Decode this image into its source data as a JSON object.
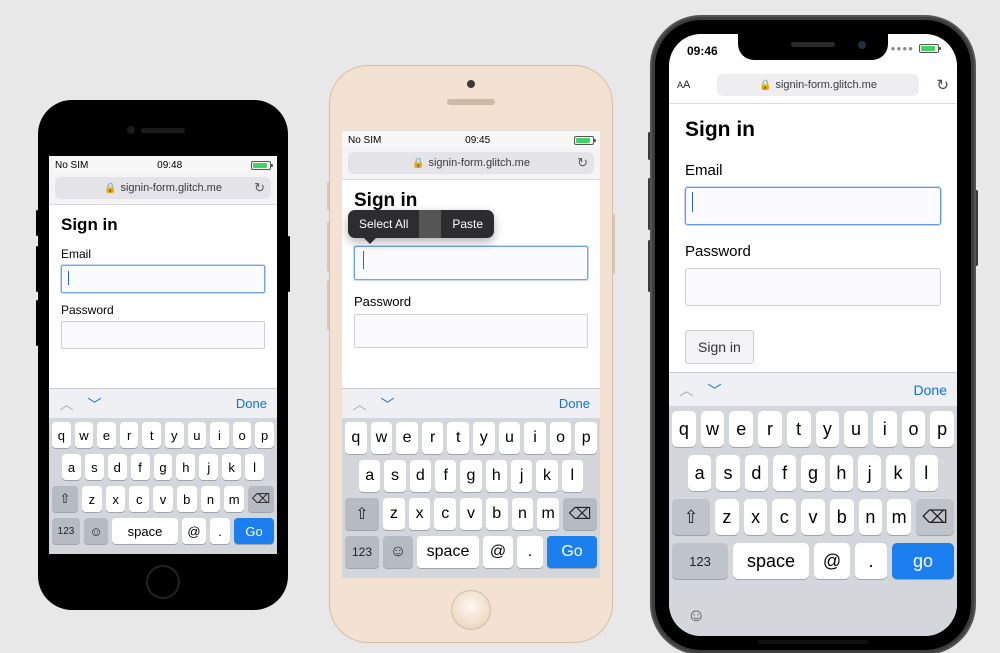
{
  "url_domain": "signin-form.glitch.me",
  "form": {
    "title": "Sign in",
    "email_label": "Email",
    "password_label": "Password",
    "signin_button": "Sign in"
  },
  "context_menu": {
    "select_all": "Select All",
    "paste": "Paste"
  },
  "keyboard": {
    "done": "Done",
    "row1": [
      "q",
      "w",
      "e",
      "r",
      "t",
      "y",
      "u",
      "i",
      "o",
      "p"
    ],
    "row2": [
      "a",
      "s",
      "d",
      "f",
      "g",
      "h",
      "j",
      "k",
      "l"
    ],
    "row3": [
      "z",
      "x",
      "c",
      "v",
      "b",
      "n",
      "m"
    ],
    "k123": "123",
    "space": "space",
    "at": "@",
    "dot": ".",
    "go": "Go",
    "go_lc": "go"
  },
  "phones": {
    "p1": {
      "carrier": "No SIM",
      "time": "09:48"
    },
    "p2": {
      "carrier": "No SIM",
      "time": "09:45"
    },
    "p3": {
      "time": "09:46",
      "aa": "AA"
    }
  }
}
